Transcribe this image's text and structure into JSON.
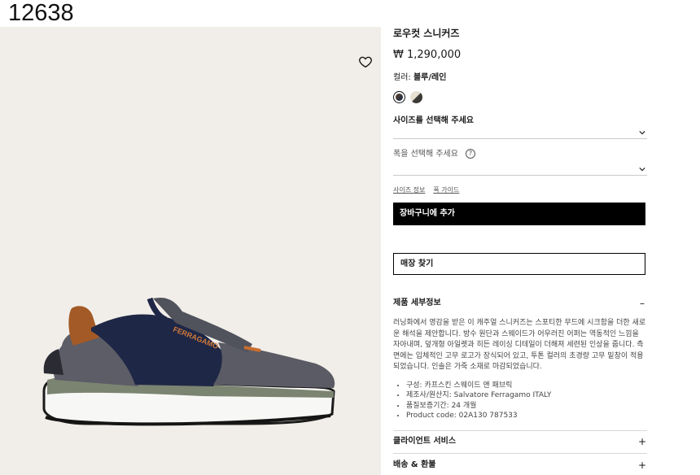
{
  "page_id": "12638",
  "product": {
    "title": "로우컷 스니커즈",
    "price": "₩ 1,290,000",
    "color_label": "컬러:",
    "color_value": "블루/레인"
  },
  "colors": {
    "swatch_selected": "#4a3b33",
    "swatch_alt": "#3b3a34",
    "panel_bg": "#f1eee9",
    "primary_button": "#000000"
  },
  "selects": {
    "size_placeholder": "사이즈를 선택해 주세요",
    "width_placeholder": "폭을 선택해 주세요",
    "help_symbol": "?"
  },
  "links": {
    "size_info": "사이즈 정보",
    "width_guide": "폭 가이드"
  },
  "buttons": {
    "add_to_cart": "장바구니에 추가",
    "find_store": "매장 찾기"
  },
  "sections": {
    "product_info": {
      "title": "제품 세부정보",
      "toggle": "–",
      "description": "러닝화에서 영감을 받은 이 캐주얼 스니커즈는 스포티한 무드에 시크함을 더한 새로운 해석을 제안합니다. 방수 원단과 스웨이드가 어우러진 어퍼는 역동적인 느낌을 자아내며, 덮개형 아일렛과 히든 레이싱 디테일이 더해져 세련된 인상을 줍니다. 측면에는 입체적인 고무 로고가 장식되어 있고, 투톤 컬러의 초경량 고무 밑창이 적용되었습니다. 인솔은 가죽 소재로 마감되었습니다.",
      "specs": [
        "구성: 카프스킨 스웨이드 앤 패브릭",
        "제조사/원산지: Salvatore Ferragamo ITALY",
        "품질보증기간: 24 개월",
        "Product code: 02A130 787533"
      ]
    },
    "client_service": {
      "title": "클라이언트 서비스",
      "toggle": "+"
    },
    "shipping": {
      "title": "배송 & 환불",
      "toggle": "+"
    }
  },
  "image": {
    "brand_mark": "FERRAGAMO",
    "icons": [
      "heart-icon",
      "chevron-down-icon",
      "help-icon"
    ]
  }
}
